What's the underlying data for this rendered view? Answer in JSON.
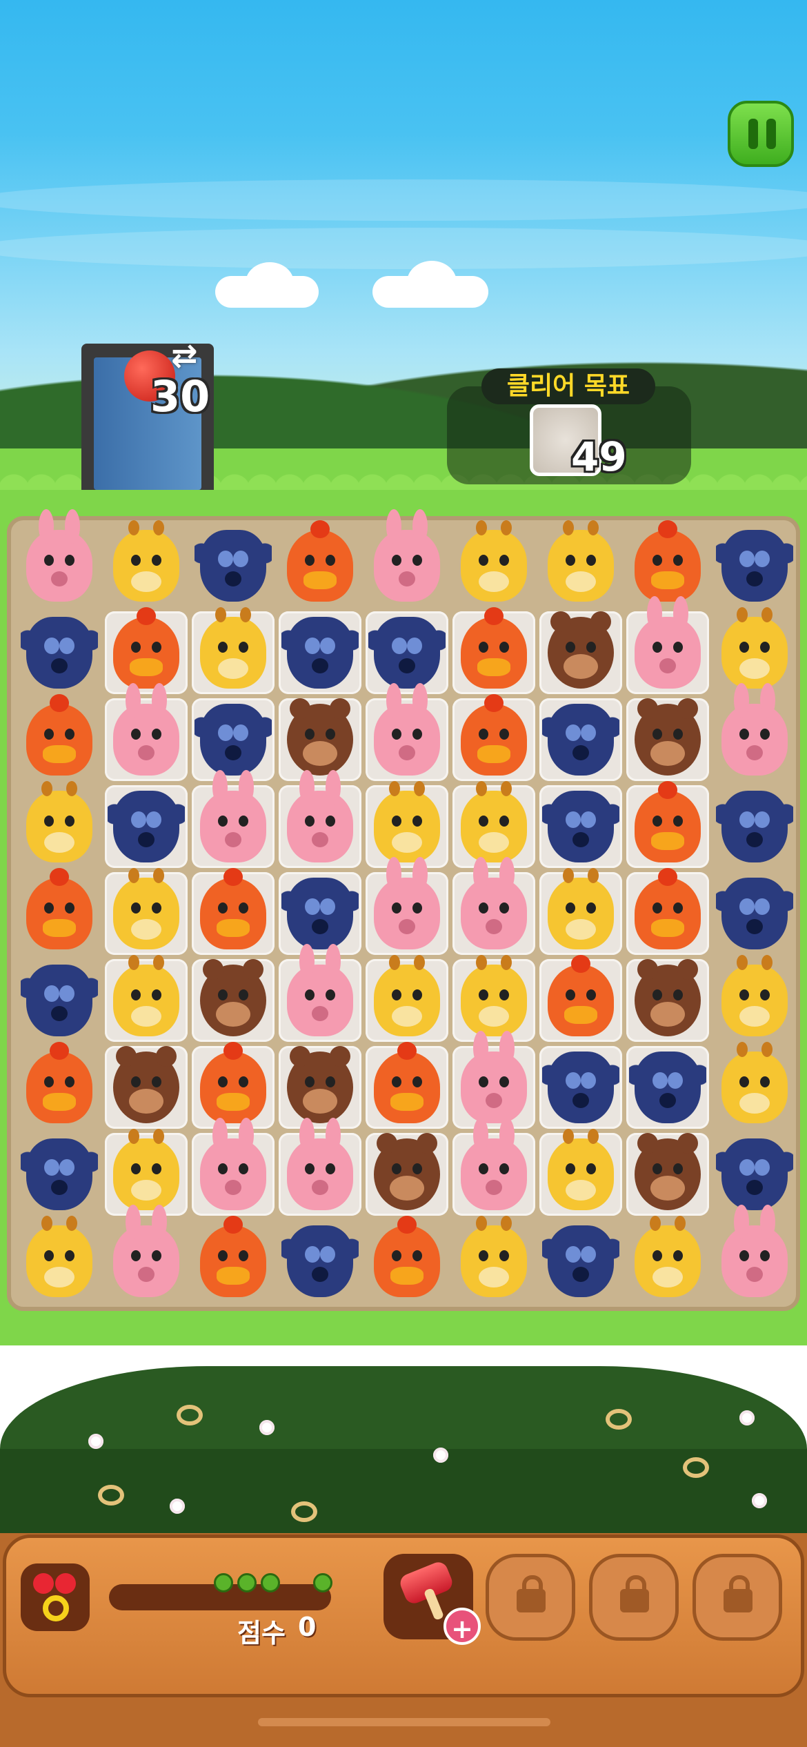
{
  "hud": {
    "moves": "30",
    "goal_title": "클리어 목표",
    "goal_count": "49"
  },
  "bottom": {
    "score_label": "점수",
    "score_value": "0",
    "booster_add": "+"
  },
  "icons": {
    "pause": "pause-icon",
    "moves": "swap-arrows-icon",
    "goal": "stone-block-icon",
    "fruit": "cherry-icon",
    "booster": "hammer-icon",
    "locked": "lock-icon"
  },
  "board": {
    "rows": [
      [
        "rabbit",
        "giraffe",
        "wolf",
        "chicken",
        "rabbit",
        "giraffe",
        "giraffe",
        "chicken",
        "wolf"
      ],
      [
        "wolf",
        "chicken",
        "giraffe",
        "wolf",
        "wolf",
        "chicken",
        "bear",
        "rabbit",
        "giraffe"
      ],
      [
        "chicken",
        "rabbit",
        "wolf",
        "bear",
        "rabbit",
        "chicken",
        "wolf",
        "bear",
        "rabbit"
      ],
      [
        "giraffe",
        "wolf",
        "rabbit",
        "rabbit",
        "giraffe",
        "giraffe",
        "wolf",
        "chicken",
        "wolf"
      ],
      [
        "chicken",
        "giraffe",
        "chicken",
        "wolf",
        "rabbit",
        "rabbit",
        "giraffe",
        "chicken",
        "wolf"
      ],
      [
        "wolf",
        "giraffe",
        "bear",
        "rabbit",
        "giraffe",
        "giraffe",
        "chicken",
        "bear",
        "giraffe"
      ],
      [
        "chicken",
        "bear",
        "chicken",
        "bear",
        "chicken",
        "rabbit",
        "wolf",
        "wolf",
        "giraffe"
      ],
      [
        "wolf",
        "giraffe",
        "rabbit",
        "rabbit",
        "bear",
        "rabbit",
        "giraffe",
        "bear",
        "wolf"
      ],
      [
        "giraffe",
        "rabbit",
        "chicken",
        "wolf",
        "chicken",
        "giraffe",
        "wolf",
        "giraffe",
        "rabbit"
      ]
    ],
    "tiles": [
      [
        0,
        0,
        0,
        0,
        0,
        0,
        0,
        0,
        0
      ],
      [
        0,
        1,
        1,
        1,
        1,
        1,
        1,
        1,
        0
      ],
      [
        0,
        1,
        1,
        1,
        1,
        1,
        1,
        1,
        0
      ],
      [
        0,
        1,
        1,
        1,
        1,
        1,
        1,
        1,
        0
      ],
      [
        0,
        1,
        1,
        1,
        1,
        1,
        1,
        1,
        0
      ],
      [
        0,
        1,
        1,
        1,
        1,
        1,
        1,
        1,
        0
      ],
      [
        0,
        1,
        1,
        1,
        1,
        1,
        1,
        1,
        0
      ],
      [
        0,
        1,
        1,
        1,
        1,
        1,
        1,
        1,
        0
      ],
      [
        0,
        0,
        0,
        0,
        0,
        0,
        0,
        0,
        0
      ]
    ]
  }
}
